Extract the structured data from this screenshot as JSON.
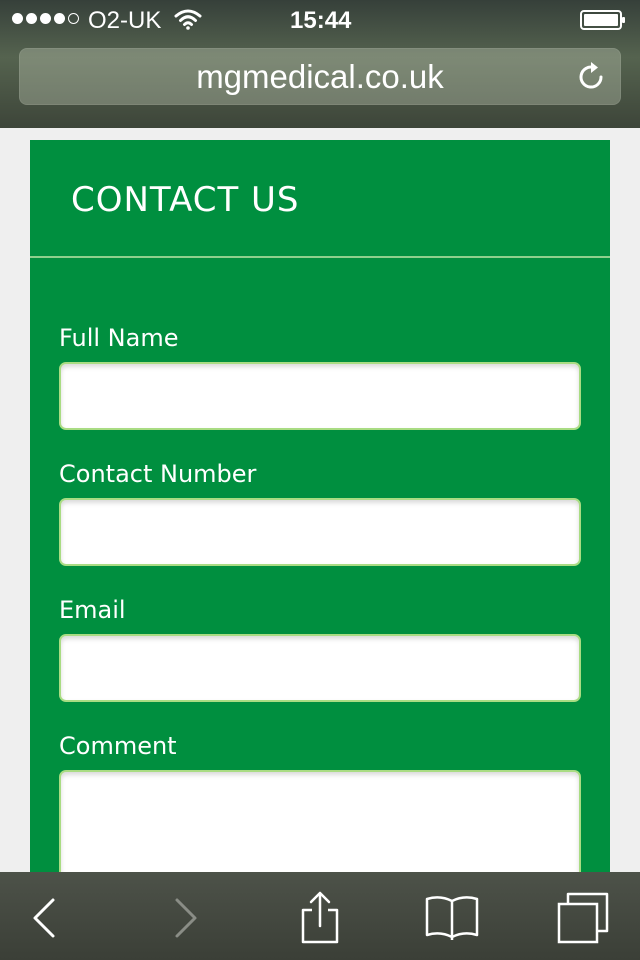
{
  "status_bar": {
    "carrier": "O2-UK",
    "time": "15:44",
    "signal_bars_filled": 4,
    "signal_bars_total": 5
  },
  "browser": {
    "url": "mgmedical.co.uk"
  },
  "contact_panel": {
    "title": "CONTACT US",
    "fields": [
      {
        "label": "Full Name",
        "value": ""
      },
      {
        "label": "Contact Number",
        "value": ""
      },
      {
        "label": "Email",
        "value": ""
      },
      {
        "label": "Comment",
        "value": ""
      }
    ]
  },
  "toolbar": {
    "back_icon": "chevron-left-icon",
    "forward_icon": "chevron-right-icon",
    "share_icon": "share-icon",
    "bookmarks_icon": "book-icon",
    "tabs_icon": "tabs-icon"
  },
  "colors": {
    "panel_green": "#008f3f",
    "field_border": "#a9dc83",
    "divider": "#8ed08d"
  }
}
